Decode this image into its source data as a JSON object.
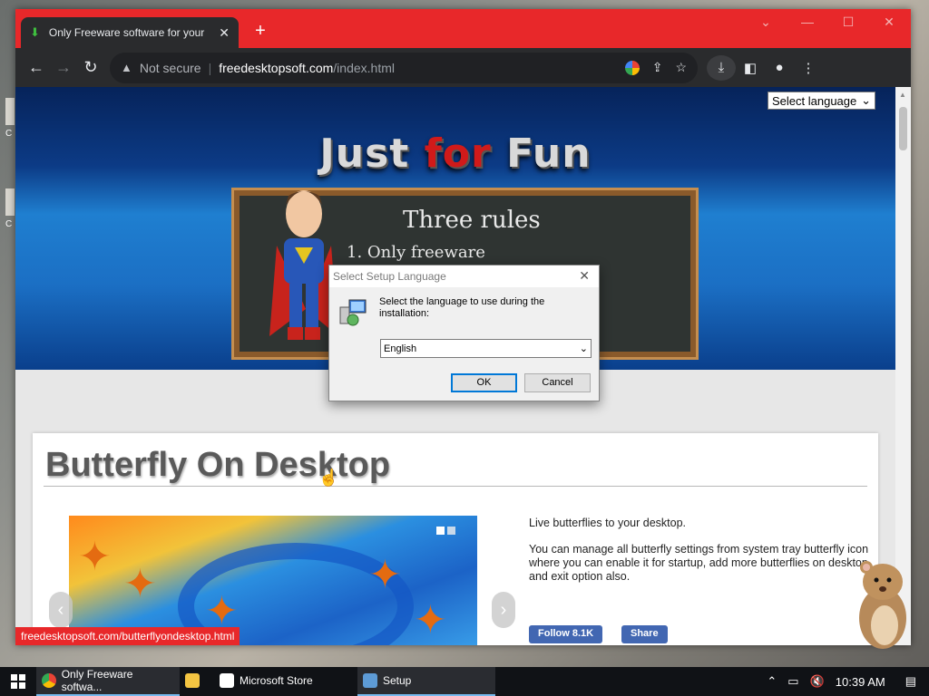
{
  "browser": {
    "tab_title": "Only Freeware software for your",
    "new_tab": "+",
    "url_warning": "Not secure",
    "url_host": "freedesktopsoft.com",
    "url_path": "/index.html",
    "status_url": "freedesktopsoft.com/butterflyondesktop.html"
  },
  "page": {
    "language_select": "Select language",
    "hero_title_1": "Just",
    "hero_title_2": "for",
    "hero_title_3": "Fun",
    "board_line1": "Three rules",
    "board_line2": "1. Only freeware",
    "app_title": "Butterfly On Desktop",
    "desc_1": "Live butterflies to your desktop.",
    "desc_2": "You can manage all butterfly settings from system tray butterfly icon where you can enable it for startup, add more butterflies on desktop and exit option also.",
    "follow_label": "Follow 8.1K",
    "share_label": "Share"
  },
  "dialog": {
    "title": "Select Setup Language",
    "prompt": "Select the language to use during the installation:",
    "selected_language": "English",
    "ok": "OK",
    "cancel": "Cancel"
  },
  "taskbar": {
    "items": [
      {
        "label": "Only Freeware softwa..."
      },
      {
        "label": ""
      },
      {
        "label": "Microsoft Store"
      },
      {
        "label": "Setup"
      }
    ],
    "time": "10:39 AM"
  }
}
